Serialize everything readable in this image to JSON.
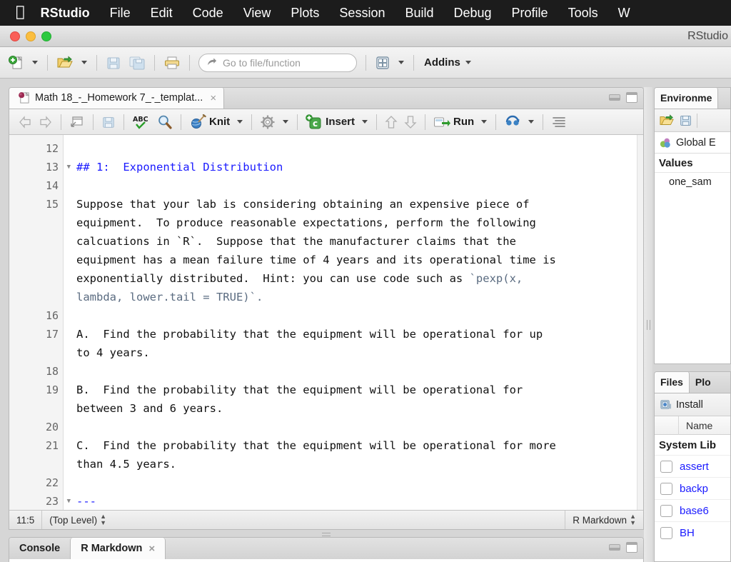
{
  "macmenu": {
    "apple": "apple-logo",
    "items": [
      "RStudio",
      "File",
      "Edit",
      "Code",
      "View",
      "Plots",
      "Session",
      "Build",
      "Debug",
      "Profile",
      "Tools",
      "W"
    ]
  },
  "window": {
    "title": "RStudio"
  },
  "toolbar": {
    "new_file": "new-file-icon",
    "open_file": "open-file-icon",
    "save": "save-icon",
    "save_all": "save-all-icon",
    "print": "print-icon",
    "goto_placeholder": "Go to file/function",
    "pane_layout": "pane-layout-icon",
    "addins_label": "Addins"
  },
  "source": {
    "tab_title": "Math 18_-_Homework 7_-_templat...",
    "tab_close": "×",
    "toolbar": {
      "knit_label": "Knit",
      "insert_label": "Insert",
      "run_label": "Run"
    },
    "lines": [
      {
        "num": "12",
        "fold": false,
        "text": ""
      },
      {
        "num": "13",
        "fold": true,
        "type": "heading",
        "text": "## 1:  Exponential Distribution"
      },
      {
        "num": "14",
        "fold": false,
        "text": ""
      },
      {
        "num": "15",
        "fold": false,
        "type": "para",
        "text": "Suppose that your lab is considering obtaining an expensive piece of"
      },
      {
        "num": "",
        "fold": false,
        "type": "para",
        "text": "equipment.  To produce reasonable expectations, perform the following"
      },
      {
        "num": "",
        "fold": false,
        "type": "para",
        "text": "calcuations in `R`.  Suppose that the manufacturer claims that the"
      },
      {
        "num": "",
        "fold": false,
        "type": "para",
        "text": "equipment has a mean failure time of 4 years and its operational time is"
      },
      {
        "num": "",
        "fold": false,
        "type": "para-code1",
        "text": "exponentially distributed.  Hint: you can use code such as `pexp(x,"
      },
      {
        "num": "",
        "fold": false,
        "type": "code",
        "text": "lambda, lower.tail = TRUE)`."
      },
      {
        "num": "16",
        "fold": false,
        "text": ""
      },
      {
        "num": "17",
        "fold": false,
        "type": "para",
        "text": "A.  Find the probability that the equipment will be operational for up"
      },
      {
        "num": "",
        "fold": false,
        "type": "para",
        "text": "to 4 years."
      },
      {
        "num": "18",
        "fold": false,
        "text": ""
      },
      {
        "num": "19",
        "fold": false,
        "type": "para",
        "text": "B.  Find the probability that the equipment will be operational for"
      },
      {
        "num": "",
        "fold": false,
        "type": "para",
        "text": "between 3 and 6 years."
      },
      {
        "num": "20",
        "fold": false,
        "text": ""
      },
      {
        "num": "21",
        "fold": false,
        "type": "para",
        "text": "C.  Find the probability that the equipment will be operational for more"
      },
      {
        "num": "",
        "fold": false,
        "type": "para",
        "text": "than 4.5 years."
      },
      {
        "num": "22",
        "fold": false,
        "text": ""
      },
      {
        "num": "23",
        "fold": true,
        "type": "rule",
        "text": "---"
      }
    ],
    "status": {
      "cursor": "11:5",
      "scope": "(Top Level)",
      "filetype": "R Markdown"
    }
  },
  "console": {
    "tabs": [
      {
        "label": "Console",
        "active": false,
        "closable": false
      },
      {
        "label": "R Markdown",
        "active": true,
        "closable": true,
        "close": "×"
      }
    ]
  },
  "environment": {
    "tab": "Environme",
    "global_env": "Global E",
    "section": "Values",
    "values": [
      {
        "name": "one_sam"
      }
    ]
  },
  "files": {
    "tabs": [
      {
        "label": "Files",
        "active": true
      },
      {
        "label": "Plo",
        "active": false
      }
    ],
    "install_label": "Install",
    "col_name": "Name",
    "group": "System Lib",
    "packages": [
      {
        "name": "assert"
      },
      {
        "name": "backp"
      },
      {
        "name": "base6"
      },
      {
        "name": "BH"
      }
    ]
  },
  "colors": {
    "heading_blue": "#1a1aff",
    "inline_code": "#5a6b80",
    "menubar_bg": "#1c1c1c",
    "pkg_link": "#1a1aff"
  }
}
